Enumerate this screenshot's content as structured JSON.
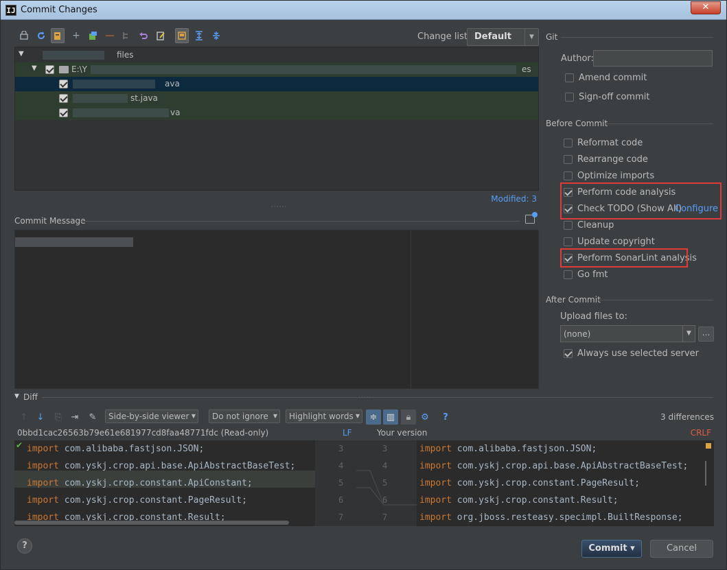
{
  "window": {
    "title": "Commit Changes",
    "close_label": "✕",
    "app_icon": "IJ"
  },
  "changelist": {
    "label": "Change list:",
    "value": "Default"
  },
  "tree": {
    "root_label": "files",
    "folder_label": "E:\\Y",
    "folder_suffix": "es",
    "files": [
      {
        "name_suffix": "ava",
        "checked": true
      },
      {
        "name_suffix": "st.java",
        "checked": true
      },
      {
        "name_suffix": "va",
        "checked": true
      }
    ]
  },
  "modified_label": "Modified: 3",
  "commit_message": {
    "label": "Commit Message"
  },
  "git": {
    "section_label": "Git",
    "author_label": "Author:",
    "author_value": "",
    "amend_commit": "Amend commit",
    "sign_off_commit": "Sign-off commit"
  },
  "before_commit": {
    "label": "Before Commit",
    "reformat_code": "Reformat code",
    "rearrange_code": "Rearrange code",
    "optimize_imports": "Optimize imports",
    "perform_code_analysis": "Perform code analysis",
    "check_todo": "Check TODO (Show All)",
    "configure_link": "Configure",
    "cleanup": "Cleanup",
    "update_copyright": "Update copyright",
    "perform_sonarlint": "Perform SonarLint analysis",
    "go_fmt": "Go fmt"
  },
  "after_commit": {
    "label": "After Commit",
    "upload_label": "Upload files to:",
    "upload_value": "(none)",
    "browse_label": "...",
    "always_use_server": "Always use selected server"
  },
  "diff": {
    "label": "Diff",
    "viewer_mode": "Side-by-side viewer",
    "ignore_mode": "Do not ignore",
    "highlight_mode": "Highlight words",
    "differences": "3 differences",
    "left_title": "0bbd1cac26563b79e61e681977cd8faa48771fdc (Read-only)",
    "left_line_sep": "LF",
    "right_title": "Your version",
    "right_line_sep": "CRLF",
    "left_lines": [
      {
        "num": "3",
        "kw": "import",
        "code": " com.alibaba.fastjson.JSON;"
      },
      {
        "num": "4",
        "kw": "import",
        "code": " com.yskj.crop.api.base.ApiAbstractBaseTest;"
      },
      {
        "num": "5",
        "kw": "import",
        "code": " com.yskj.crop.constant.ApiConstant;"
      },
      {
        "num": "6",
        "kw": "import",
        "code": " com.yskj.crop.constant.PageResult;"
      },
      {
        "num": "7",
        "kw": "import",
        "code": " com.yskj.crop.constant.Result;"
      }
    ],
    "right_lines": [
      {
        "num": "3",
        "kw": "import",
        "code": " com.alibaba.fastjson.JSON;"
      },
      {
        "num": "4",
        "kw": "import",
        "code": " com.yskj.crop.api.base.ApiAbstractBaseTest;"
      },
      {
        "num": "5",
        "kw": "import",
        "code": " com.yskj.crop.constant.PageResult;"
      },
      {
        "num": "6",
        "kw": "import",
        "code": " com.yskj.crop.constant.Result;"
      },
      {
        "num": "7",
        "kw": "import",
        "code": " org.jboss.resteasy.specimpl.BuiltResponse;"
      }
    ]
  },
  "buttons": {
    "help": "?",
    "commit": "Commit",
    "commit_arrow": "▾",
    "cancel": "Cancel"
  },
  "colors": {
    "accent_link": "#589df6",
    "highlight_border": "#e03b3b",
    "keyword": "#cc7832"
  }
}
